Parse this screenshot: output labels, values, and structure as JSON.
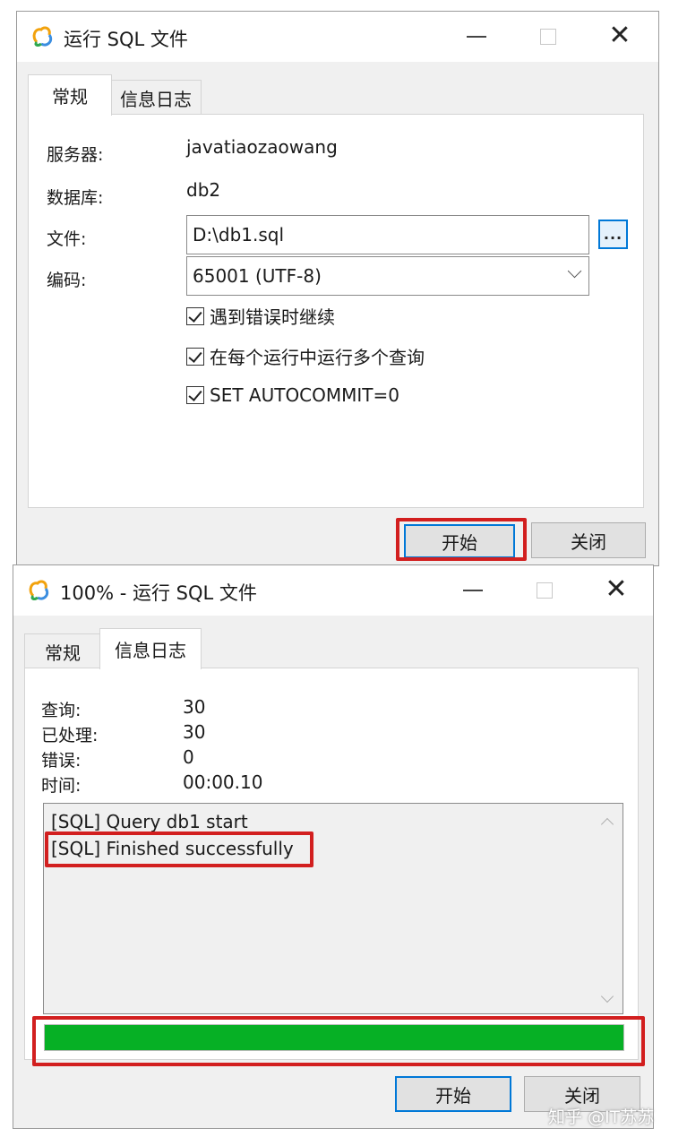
{
  "dialog1": {
    "title": "运行 SQL 文件",
    "tabs": [
      {
        "label": "常规",
        "active": true
      },
      {
        "label": "信息日志",
        "active": false
      }
    ],
    "server_label": "服务器:",
    "server_value": "javatiaozaowang",
    "database_label": "数据库:",
    "database_value": "db2",
    "file_label": "文件:",
    "file_value": "D:\\db1.sql",
    "browse_label": "...",
    "encoding_label": "编码:",
    "encoding_value": "65001 (UTF-8)",
    "options": [
      {
        "label": "遇到错误时继续",
        "checked": true
      },
      {
        "label": "在每个运行中运行多个查询",
        "checked": true
      },
      {
        "label": "SET AUTOCOMMIT=0",
        "checked": true
      }
    ],
    "start_button": "开始",
    "close_button": "关闭"
  },
  "dialog2": {
    "title": "100% - 运行 SQL 文件",
    "tabs": [
      {
        "label": "常规",
        "active": false
      },
      {
        "label": "信息日志",
        "active": true
      }
    ],
    "stats": [
      {
        "label": "查询:",
        "value": "30"
      },
      {
        "label": "已处理:",
        "value": "30"
      },
      {
        "label": "错误:",
        "value": "0"
      },
      {
        "label": "时间:",
        "value": "00:00.10"
      }
    ],
    "log_lines": [
      "[SQL] Query db1 start",
      "[SQL] Finished successfully"
    ],
    "progress_percent": 100,
    "start_button": "开始",
    "close_button": "关闭"
  },
  "colors": {
    "highlight": "#d21f1f",
    "progress": "#06b025",
    "accent": "#0078d7"
  },
  "icons": {
    "app": "navicat-app-icon",
    "minimize": "minimize-icon",
    "maximize": "maximize-icon",
    "close": "close-icon"
  },
  "watermark": "知乎 @IT苏苏"
}
